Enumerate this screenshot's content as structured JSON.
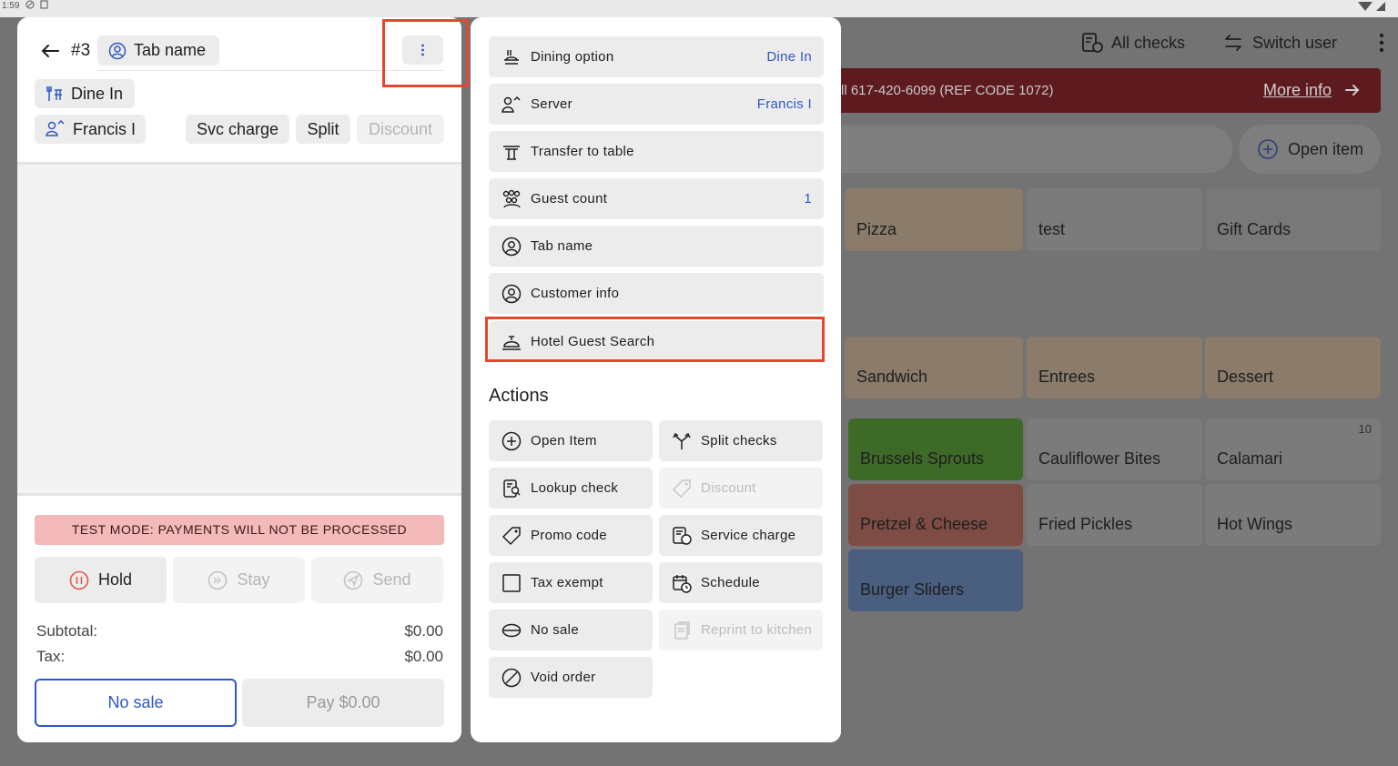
{
  "status_bar": {
    "time": "1:59"
  },
  "background": {
    "all_checks": "All checks",
    "switch_user": "Switch user",
    "banner_text": "ll 617-420-6099 (REF CODE 1072)",
    "more_info": "More info",
    "open_item": "Open item",
    "tiles": [
      {
        "label": "Pizza",
        "color": "#8a7b6a"
      },
      {
        "label": "test",
        "color": "#7b7b7b"
      },
      {
        "label": "Gift Cards",
        "color": "#787878"
      },
      {
        "label": "Sandwich",
        "color": "#8a7b6a"
      },
      {
        "label": "Entrees",
        "color": "#8a7b6a"
      },
      {
        "label": "Dessert",
        "color": "#8a7b6a"
      },
      {
        "label": "Brussels Sprouts",
        "color": "#3e6a28"
      },
      {
        "label": "Cauliflower Bites",
        "color": "#7b7b7b"
      },
      {
        "label": "Calamari",
        "color": "#7b7b7b",
        "count": "10"
      },
      {
        "label": "Pretzel & Cheese",
        "color": "#7d4c45"
      },
      {
        "label": "Fried Pickles",
        "color": "#7b7b7b"
      },
      {
        "label": "Hot Wings",
        "color": "#7b7b7b"
      },
      {
        "label": "Burger Sliders",
        "color": "#4a5e80"
      }
    ]
  },
  "check": {
    "number": "#3",
    "tab_name": "Tab name",
    "dining": "Dine In",
    "server": "Francis I",
    "svc_charge": "Svc charge",
    "split": "Split",
    "discount": "Discount",
    "test_mode": "TEST MODE:  PAYMENTS WILL NOT BE PROCESSED",
    "hold": "Hold",
    "stay": "Stay",
    "send": "Send",
    "subtotal_label": "Subtotal:",
    "subtotal_value": "$0.00",
    "tax_label": "Tax:",
    "tax_value": "$0.00",
    "no_sale": "No sale",
    "pay": "Pay $0.00"
  },
  "menu": {
    "items": [
      {
        "label": "Dining option",
        "value": "Dine In"
      },
      {
        "label": "Server",
        "value": "Francis I"
      },
      {
        "label": "Transfer to table",
        "value": ""
      },
      {
        "label": "Guest count",
        "value": "1"
      },
      {
        "label": "Tab name",
        "value": ""
      },
      {
        "label": "Customer info",
        "value": ""
      },
      {
        "label": "Hotel Guest Search",
        "value": ""
      }
    ],
    "actions_title": "Actions",
    "actions": [
      {
        "label": "Open Item",
        "disabled": false
      },
      {
        "label": "Split checks",
        "disabled": false
      },
      {
        "label": "Lookup check",
        "disabled": false
      },
      {
        "label": "Discount",
        "disabled": true
      },
      {
        "label": "Promo code",
        "disabled": false
      },
      {
        "label": "Service charge",
        "disabled": false
      },
      {
        "label": "Tax exempt",
        "disabled": false
      },
      {
        "label": "Schedule",
        "disabled": false
      },
      {
        "label": "No sale",
        "disabled": false
      },
      {
        "label": "Reprint to kitchen",
        "disabled": true
      },
      {
        "label": "Void order",
        "disabled": false
      }
    ]
  },
  "colors": {
    "accent": "#2f56c9",
    "highlight": "#e8452c",
    "test_mode_bg": "#f4b9b9",
    "banner_bg": "#5e1b1f"
  }
}
